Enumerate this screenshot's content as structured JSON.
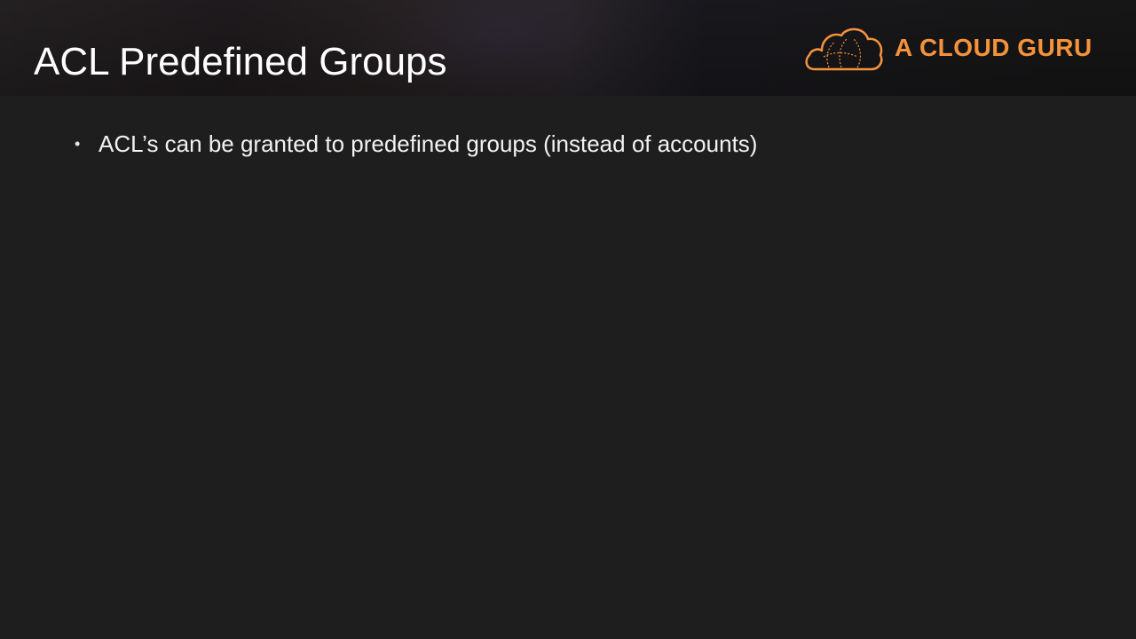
{
  "slide": {
    "title": "ACL Predefined Groups",
    "brand": {
      "name": "A CLOUD GURU",
      "logo_icon": "cloud-logo-icon",
      "color": "#f4933c"
    },
    "bullets": [
      {
        "marker": "•",
        "text": "ACL’s can be granted to predefined groups (instead of accounts)"
      }
    ]
  },
  "colors": {
    "background": "#1e1e1e",
    "title_text": "#ffffff",
    "body_text": "#f2f2f2",
    "accent": "#f4933c"
  }
}
